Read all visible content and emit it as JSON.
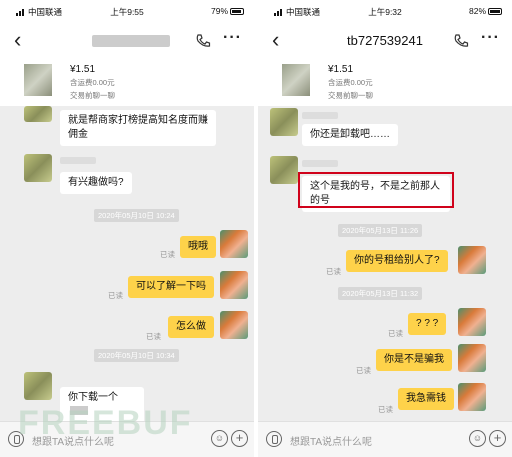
{
  "left": {
    "status": {
      "carrier": "中国联通",
      "time": "上午9:55",
      "battery": "79%"
    },
    "item": {
      "price": "¥1.51",
      "shipping": "含运费0.00元",
      "trade": "交易前聊一聊"
    },
    "messages": {
      "m1": "就是帮商家打榜提高知名度而赚佣金",
      "m2": "有兴趣做吗?",
      "ts1": "2020年05月10日 10:24",
      "m3": "哦哦",
      "m4": "可以了解一下吗",
      "m5": "怎么做",
      "read": "已读",
      "ts2": "2020年05月10日 10:34",
      "m6": "你下载一个"
    },
    "input_placeholder": "想跟TA说点什么呢"
  },
  "right": {
    "status": {
      "carrier": "中国联通",
      "time": "上午9:32",
      "battery": "82%"
    },
    "title": "tb727539241",
    "item": {
      "price": "¥1.51",
      "shipping": "含运费0.00元",
      "trade": "交易前聊一聊"
    },
    "messages": {
      "m1": "你还是卸载吧……",
      "m2": "这个是我的号，不是之前那人的号",
      "ts1": "2020年05月13日 11:26",
      "m3": "你的号租给别人了?",
      "ts2": "2020年05月13日 11:32",
      "m4": "? ? ?",
      "m5": "你是不是骗我",
      "m6": "我急需钱",
      "read": "已读"
    },
    "input_placeholder": "想跟TA说点什么呢"
  },
  "watermark": "FREEBUF",
  "icons": {
    "back": "back-chevron-icon",
    "phone": "phone-call-icon",
    "more": "more-icon",
    "mic": "voice-icon",
    "emoji": "emoji-icon",
    "plus": "plus-icon"
  }
}
